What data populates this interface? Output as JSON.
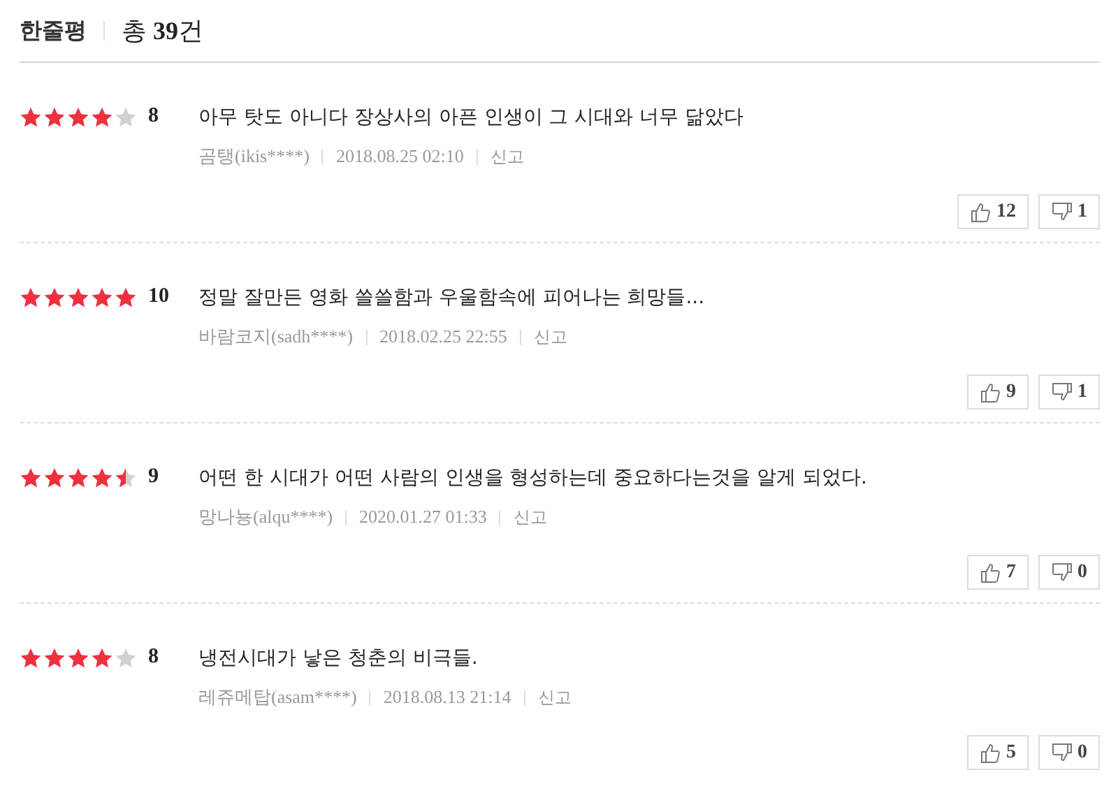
{
  "header": {
    "title": "한줄평",
    "count": "총 **39**건"
  },
  "reviews": [
    {
      "stars": 4,
      "score": "8",
      "text": "아무 탓도 아니다 장상사의 아픈 인생이 그 시대와 너무 닮았다",
      "author": "곰탱(ikis****)",
      "date": "2018.08.25 02:10",
      "report": "신고",
      "likes": "12",
      "dislikes": "1"
    },
    {
      "stars": 5,
      "score": "10",
      "text": "정말 잘만든 영화 쓸쓸함과 우울함속에 피어나는 희망들...",
      "author": "바람코지(sadh****)",
      "date": "2018.02.25 22:55",
      "report": "신고",
      "likes": "9",
      "dislikes": "1"
    },
    {
      "stars": 4.5,
      "score": "9",
      "text": "어떤 한 시대가 어떤 사람의 인생을 형성하는데 중요하다는것을 알게 되었다.",
      "author": "망나뇽(alqu****)",
      "date": "2020.01.27 01:33",
      "report": "신고",
      "likes": "7",
      "dislikes": "0"
    },
    {
      "stars": 4,
      "score": "8",
      "text": "냉전시대가 낳은 청춘의 비극들.",
      "author": "레쥬메탑(asam****)",
      "date": "2018.08.13 21:14",
      "report": "신고",
      "likes": "5",
      "dislikes": "0"
    }
  ]
}
